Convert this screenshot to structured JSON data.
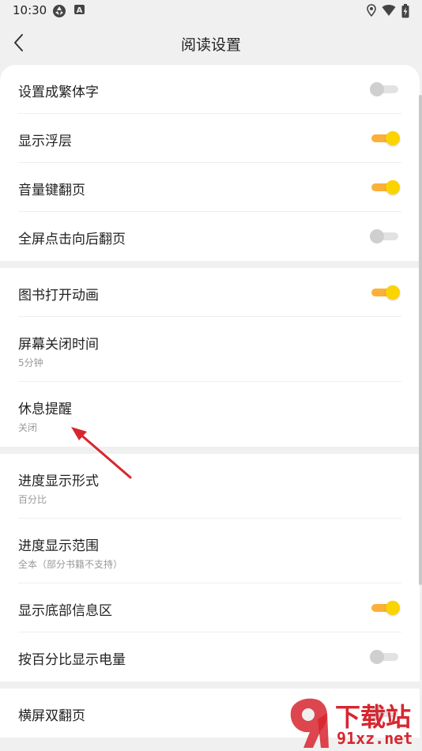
{
  "status_bar": {
    "time": "10:30",
    "icons": [
      "aperture-icon",
      "a-badge-icon",
      "location-icon",
      "wifi-icon",
      "battery-charging-icon"
    ]
  },
  "header": {
    "title": "阅读设置",
    "back_icon": "chevron-left-icon"
  },
  "groups": [
    {
      "items": [
        {
          "label": "设置成繁体字",
          "toggle": "off"
        },
        {
          "label": "显示浮层",
          "toggle": "on"
        },
        {
          "label": "音量键翻页",
          "toggle": "on"
        },
        {
          "label": "全屏点击向后翻页",
          "toggle": "off"
        }
      ]
    },
    {
      "items": [
        {
          "label": "图书打开动画",
          "toggle": "on"
        },
        {
          "label": "屏幕关闭时间",
          "value": "5分钟"
        },
        {
          "label": "休息提醒",
          "value": "关闭"
        }
      ]
    },
    {
      "items": [
        {
          "label": "进度显示形式",
          "value": "百分比"
        },
        {
          "label": "进度显示范围",
          "value": "全本（部分书籍不支持）"
        },
        {
          "label": "显示底部信息区",
          "toggle": "on"
        },
        {
          "label": "按百分比显示电量",
          "toggle": "off"
        }
      ]
    },
    {
      "items": [
        {
          "label": "横屏双翻页",
          "toggle": "off"
        }
      ]
    }
  ],
  "colors": {
    "toggle_on_track": "#fbb03a",
    "toggle_on_knob": "#fbd400",
    "toggle_off_knob": "#cfcfcf",
    "annotation_arrow": "#d7262f",
    "background": "#f0f0f0"
  },
  "watermark": {
    "line1": "下载站",
    "line2": "91xz.net"
  }
}
